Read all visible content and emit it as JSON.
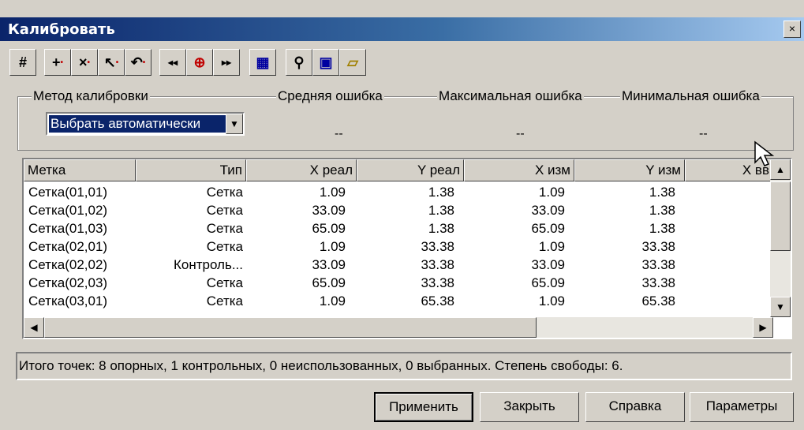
{
  "window": {
    "title": "Калибровать",
    "close_glyph": "×"
  },
  "toolbar": [
    {
      "icon": "grid-icon",
      "glyph": "#"
    },
    {
      "icon": "add-point-icon",
      "glyph": "+"
    },
    {
      "icon": "delete-point-icon",
      "glyph": "×"
    },
    {
      "icon": "select-arrow-icon",
      "glyph": "↖"
    },
    {
      "icon": "undo-icon",
      "glyph": "↶"
    },
    {
      "icon": "prev-point-icon",
      "glyph": "◂◂"
    },
    {
      "icon": "zoom-icon",
      "glyph": "⊕"
    },
    {
      "icon": "next-point-icon",
      "glyph": "▸▸"
    },
    {
      "icon": "mesh-icon",
      "glyph": "▦"
    },
    {
      "icon": "find-icon",
      "glyph": "⚲"
    },
    {
      "icon": "save-icon",
      "glyph": "▣"
    },
    {
      "icon": "open-icon",
      "glyph": "▱"
    }
  ],
  "method": {
    "label": "Метод калибровки",
    "value": "Выбрать автоматически"
  },
  "errors": {
    "avg_label": "Средняя ошибка",
    "avg_value": "--",
    "max_label": "Максимальная ошибка",
    "max_value": "--",
    "min_label": "Минимальная ошибка",
    "min_value": "--"
  },
  "table": {
    "columns": [
      "Метка",
      "Тип",
      "X реал",
      "Y реал",
      "X изм",
      "Y изм",
      "X вв"
    ],
    "rows": [
      [
        "Сетка(01,01)",
        "Сетка",
        "1.09",
        "1.38",
        "1.09",
        "1.38"
      ],
      [
        "Сетка(01,02)",
        "Сетка",
        "33.09",
        "1.38",
        "33.09",
        "1.38"
      ],
      [
        "Сетка(01,03)",
        "Сетка",
        "65.09",
        "1.38",
        "65.09",
        "1.38"
      ],
      [
        "Сетка(02,01)",
        "Сетка",
        "1.09",
        "33.38",
        "1.09",
        "33.38"
      ],
      [
        "Сетка(02,02)",
        "Контроль...",
        "33.09",
        "33.38",
        "33.09",
        "33.38"
      ],
      [
        "Сетка(02,03)",
        "Сетка",
        "65.09",
        "33.38",
        "65.09",
        "33.38"
      ],
      [
        "Сетка(03,01)",
        "Сетка",
        "1.09",
        "65.38",
        "1.09",
        "65.38"
      ]
    ]
  },
  "status": "Итого точек: 8 опорных, 1 контрольных, 0 неиспользованных, 0 выбранных. Степень свободы: 6.",
  "buttons": {
    "apply": "Применить",
    "close": "Закрыть",
    "help": "Справка",
    "params": "Параметры"
  },
  "scroll": {
    "up": "▲",
    "down": "▼",
    "left": "◀",
    "right": "▶",
    "dropdown": "▼"
  }
}
